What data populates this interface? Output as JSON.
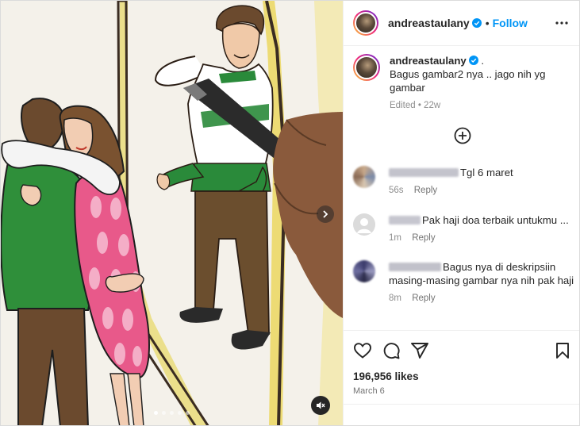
{
  "post": {
    "username": "andreastaulany",
    "follow_label": "Follow",
    "separator": "•",
    "caption_text": "Bagus gambar2 nya .. jago nih yg gambar",
    "caption_dot": ".",
    "edited_label": "Edited",
    "caption_age": "22w",
    "likes": "196,956 likes",
    "date": "March 6"
  },
  "comments": [
    {
      "text": "Tgl 6 maret",
      "age": "56s",
      "reply_label": "Reply"
    },
    {
      "text": "Pak haji doa terbaik untukmu ...",
      "age": "1m",
      "reply_label": "Reply"
    },
    {
      "text": "Bagus nya di deskripsiin masing-masing gambar nya nih pak haji",
      "age": "8m",
      "reply_label": "Reply"
    }
  ],
  "carousel": {
    "slides": 5,
    "active": 0
  },
  "icons": {
    "more": "more-options-icon",
    "verified": "verified-badge-icon",
    "load_more": "load-more-comments-icon",
    "next": "chevron-right-icon",
    "mute": "audio-muted-icon",
    "like": "heart-icon",
    "comment": "comment-icon",
    "share": "share-icon",
    "save": "bookmark-icon"
  },
  "colors": {
    "accent": "#0095f6",
    "verified": "#0095f6",
    "text": "#262626",
    "muted": "#8e8e8e"
  }
}
